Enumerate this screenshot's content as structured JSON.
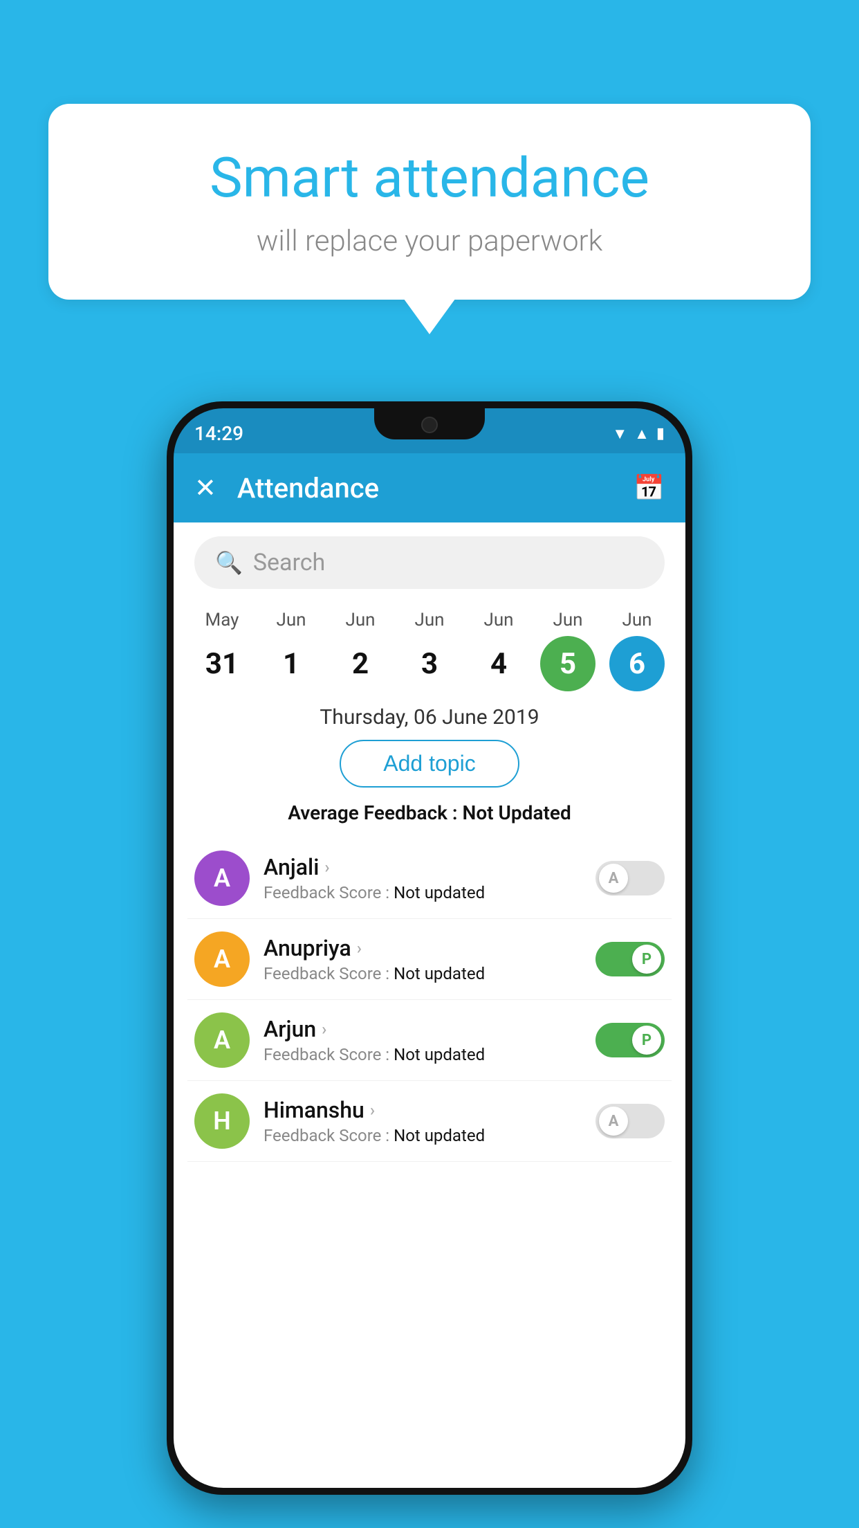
{
  "background_color": "#29b6e8",
  "speech_bubble": {
    "title": "Smart attendance",
    "subtitle": "will replace your paperwork"
  },
  "phone": {
    "status_bar": {
      "time": "14:29",
      "wifi_icon": "▼",
      "signal_icon": "▲",
      "battery_icon": "▮"
    },
    "app_bar": {
      "close_label": "✕",
      "title": "Attendance",
      "calendar_icon": "📅"
    },
    "search": {
      "placeholder": "Search"
    },
    "calendar": {
      "days": [
        {
          "month": "May",
          "date": "31",
          "state": "normal"
        },
        {
          "month": "Jun",
          "date": "1",
          "state": "normal"
        },
        {
          "month": "Jun",
          "date": "2",
          "state": "normal"
        },
        {
          "month": "Jun",
          "date": "3",
          "state": "normal"
        },
        {
          "month": "Jun",
          "date": "4",
          "state": "normal"
        },
        {
          "month": "Jun",
          "date": "5",
          "state": "today"
        },
        {
          "month": "Jun",
          "date": "6",
          "state": "selected"
        }
      ]
    },
    "date_header": "Thursday, 06 June 2019",
    "add_topic_label": "Add topic",
    "avg_feedback_label": "Average Feedback : ",
    "avg_feedback_value": "Not Updated",
    "students": [
      {
        "name": "Anjali",
        "initial": "A",
        "avatar_color": "#9c4dcc",
        "feedback_label": "Feedback Score : ",
        "feedback_value": "Not updated",
        "toggle_state": "off",
        "toggle_letter": "A"
      },
      {
        "name": "Anupriya",
        "initial": "A",
        "avatar_color": "#f5a623",
        "feedback_label": "Feedback Score : ",
        "feedback_value": "Not updated",
        "toggle_state": "on",
        "toggle_letter": "P"
      },
      {
        "name": "Arjun",
        "initial": "A",
        "avatar_color": "#8bc34a",
        "feedback_label": "Feedback Score : ",
        "feedback_value": "Not updated",
        "toggle_state": "on",
        "toggle_letter": "P"
      },
      {
        "name": "Himanshu",
        "initial": "H",
        "avatar_color": "#8bc34a",
        "feedback_label": "Feedback Score : ",
        "feedback_value": "Not updated",
        "toggle_state": "off",
        "toggle_letter": "A"
      }
    ]
  }
}
